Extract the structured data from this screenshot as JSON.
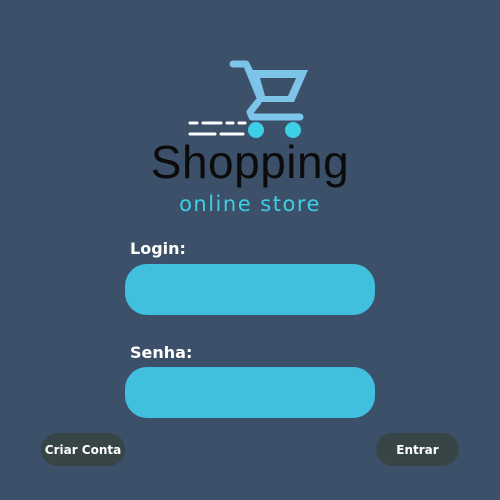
{
  "brand": {
    "title": "Shopping",
    "subtitle": "online store",
    "logo_icon": "shopping-cart-icon"
  },
  "form": {
    "login_label": "Login:",
    "login_value": "",
    "senha_label": "Senha:",
    "senha_value": ""
  },
  "actions": {
    "create_account_label": "Criar Conta",
    "enter_label": "Entrar"
  },
  "colors": {
    "background": "#3d5069",
    "accent": "#41bfde",
    "button": "#374547",
    "cart": "#7cc4e8",
    "wheels": "#3ccfe6"
  }
}
